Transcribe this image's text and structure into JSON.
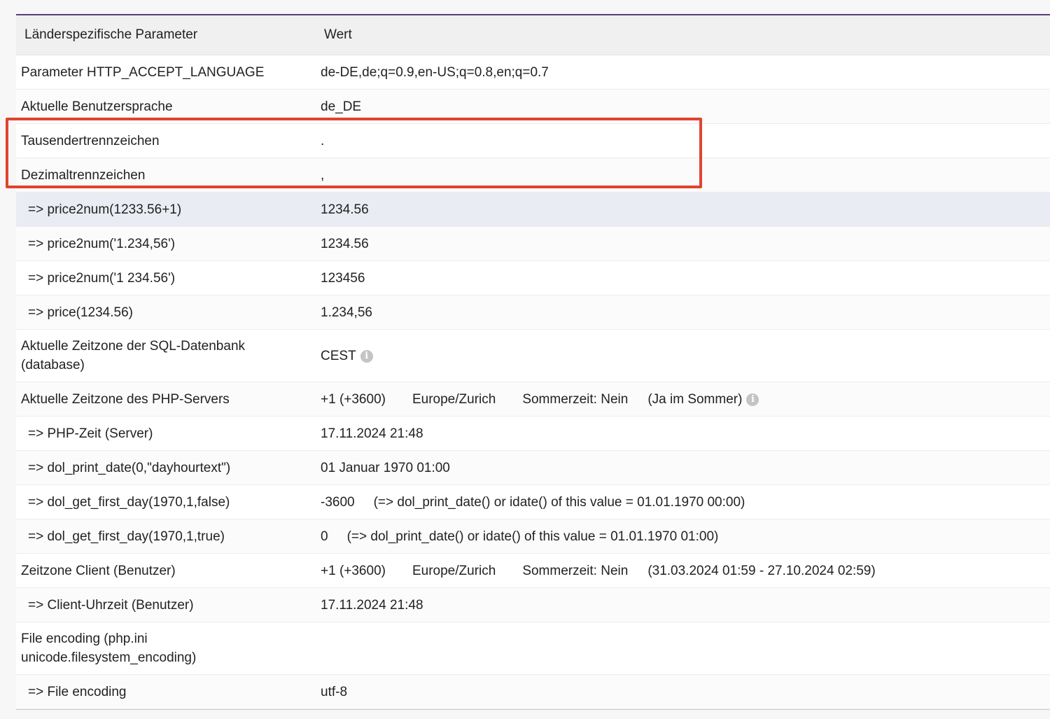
{
  "table": {
    "header": {
      "param": "Länderspezifische Parameter",
      "value": "Wert"
    },
    "rows": [
      {
        "label": "Parameter HTTP_ACCEPT_LANGUAGE",
        "value": "de-DE,de;q=0.9,en-US;q=0.8,en;q=0.7"
      },
      {
        "label": "Aktuelle Benutzersprache",
        "value": "de_DE"
      },
      {
        "label": "Tausendertrennzeichen",
        "value": "."
      },
      {
        "label": "Dezimaltrennzeichen",
        "value": ","
      },
      {
        "label": "=> price2num(1233.56+1)",
        "value": "1234.56"
      },
      {
        "label": "=> price2num('1.234,56')",
        "value": "1234.56"
      },
      {
        "label": "=> price2num('1 234.56')",
        "value": "123456"
      },
      {
        "label": "=> price(1234.56)",
        "value": "1.234,56"
      },
      {
        "label": "Aktuelle Zeitzone der SQL-Datenbank (database)",
        "value": "CEST"
      },
      {
        "label": "Aktuelle Zeitzone des PHP-Servers",
        "offset": "+1 (+3600)",
        "zone": "Europe/Zurich",
        "dst": "Sommerzeit: Nein",
        "note": "(Ja im Sommer)"
      },
      {
        "label": "=> PHP-Zeit (Server)",
        "value": "17.11.2024 21:48"
      },
      {
        "label": "=> dol_print_date(0,\"dayhourtext\")",
        "value": "01 Januar 1970 01:00"
      },
      {
        "label": "=> dol_get_first_day(1970,1,false)",
        "value": "-3600",
        "note": "(=> dol_print_date() or idate() of this value = 01.01.1970 00:00)"
      },
      {
        "label": "=> dol_get_first_day(1970,1,true)",
        "value": "0",
        "note": "(=> dol_print_date() or idate() of this value = 01.01.1970 01:00)"
      },
      {
        "label": "Zeitzone Client (Benutzer)",
        "offset": "+1 (+3600)",
        "zone": "Europe/Zurich",
        "dst": "Sommerzeit: Nein",
        "note": "(31.03.2024 01:59 - 27.10.2024 02:59)"
      },
      {
        "label": "=> Client-Uhrzeit (Benutzer)",
        "value": "17.11.2024 21:48"
      },
      {
        "label": "File encoding (php.ini unicode.filesystem_encoding)",
        "value": ""
      },
      {
        "label": "=> File encoding",
        "value": "utf-8"
      }
    ]
  },
  "icons": {
    "info": "info-circle-icon",
    "info_glyph": "i"
  },
  "colors": {
    "highlight_border": "#e0442e",
    "header_rule": "#5a3d7a",
    "hover_row": "#e9ecf2"
  }
}
